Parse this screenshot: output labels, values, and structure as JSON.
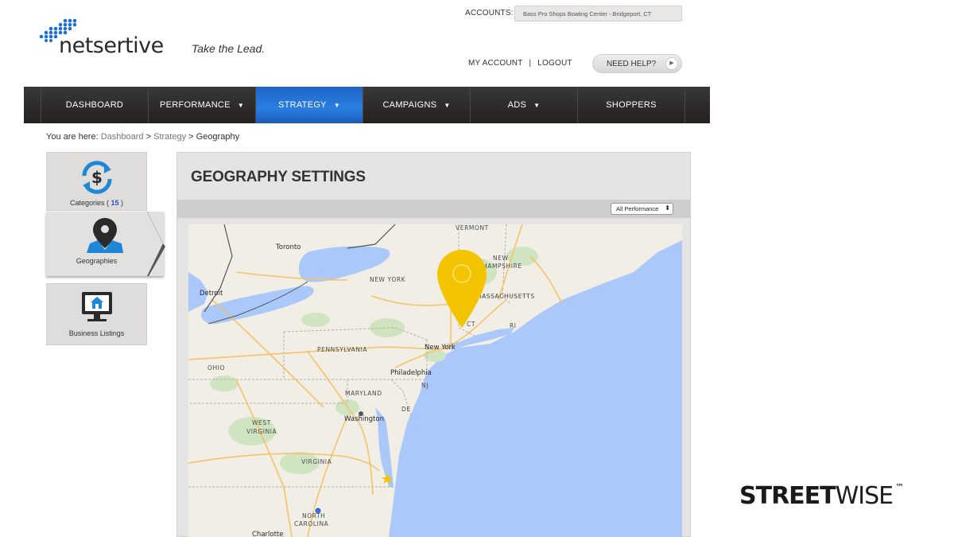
{
  "brand": {
    "name": "netsertive",
    "tagline": "Take the Lead."
  },
  "accounts": {
    "label": "ACCOUNTS:",
    "selected": "Bass Pro Shops Boating Center - Bridgeport, CT"
  },
  "account_links": {
    "my_account": "MY ACCOUNT",
    "separator": "|",
    "logout": "LOGOUT"
  },
  "help": {
    "label": "NEED HELP?",
    "icon": "play-arrow-icon"
  },
  "nav": {
    "items": [
      {
        "label": "DASHBOARD",
        "has_caret": false,
        "active": false
      },
      {
        "label": "PERFORMANCE",
        "has_caret": true,
        "active": false
      },
      {
        "label": "STRATEGY",
        "has_caret": true,
        "active": true
      },
      {
        "label": "CAMPAIGNS",
        "has_caret": true,
        "active": false
      },
      {
        "label": "ADS",
        "has_caret": true,
        "active": false
      },
      {
        "label": "SHOPPERS",
        "has_caret": false,
        "active": false
      }
    ],
    "active_color": "#2b7fe0"
  },
  "breadcrumb": {
    "prefix": "You are here:",
    "items": [
      "Dashboard",
      ">",
      "Strategy",
      ">",
      "Geography"
    ]
  },
  "side_menu": {
    "categories": {
      "label": "Categories (",
      "count": "15",
      "suffix": " )",
      "icon": "dollar-refresh-icon"
    },
    "geographies": {
      "label": "Geographies",
      "icon": "map-pin-icon",
      "selected": true
    },
    "business_listings": {
      "label": "Business Listings",
      "icon": "monitor-home-icon"
    }
  },
  "panel": {
    "title": "GEOGRAPHY SETTINGS",
    "filter": {
      "selected": "All Performance"
    }
  },
  "map": {
    "regions": [
      "VERMONT",
      "NEW",
      "HAMPSHIRE",
      "NEW YORK",
      "MASSACHUSETTS",
      "CT",
      "RI",
      "PENNSYLVANIA",
      "OHIO",
      "MARYLAND",
      "NJ",
      "DE",
      "WEST",
      "VIRGINIA",
      "VIRGINIA",
      "NORTH",
      "CAROLINA"
    ],
    "cities": [
      "Toronto",
      "Detroit",
      "New York",
      "Philadelphia",
      "Washington",
      "Charlotte"
    ],
    "marker_color": "#f5c400"
  },
  "watermark": {
    "part1": "STREET",
    "part2": "WISE",
    "tm": "™"
  }
}
